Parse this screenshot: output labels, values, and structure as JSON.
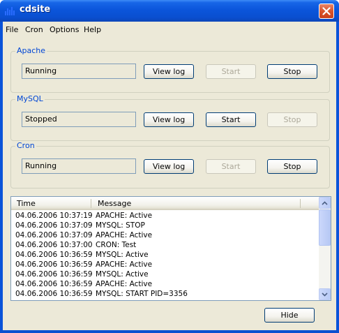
{
  "window": {
    "title": "cdsite"
  },
  "menu": {
    "items": [
      "File",
      "Cron",
      "Options",
      "Help"
    ]
  },
  "groups": [
    {
      "label": "Apache",
      "status": "Running",
      "view_log": "View log",
      "start": "Start",
      "stop": "Stop",
      "start_enabled": false,
      "stop_enabled": true
    },
    {
      "label": "MySQL",
      "status": "Stopped",
      "view_log": "View log",
      "start": "Start",
      "stop": "Stop",
      "start_enabled": true,
      "stop_enabled": false
    },
    {
      "label": "Cron",
      "status": "Running",
      "view_log": "View log",
      "start": "Start",
      "stop": "Stop",
      "start_enabled": false,
      "stop_enabled": true
    }
  ],
  "log": {
    "columns": [
      "Time",
      "Message"
    ],
    "rows": [
      [
        "04.06.2006 10:37:19",
        "APACHE: Active"
      ],
      [
        "04.06.2006 10:37:09",
        "MYSQL: STOP"
      ],
      [
        "04.06.2006 10:37:09",
        "APACHE: Active"
      ],
      [
        "04.06.2006 10:37:00",
        "CRON: Test"
      ],
      [
        "04.06.2006 10:36:59",
        "MYSQL: Active"
      ],
      [
        "04.06.2006 10:36:59",
        "APACHE: Active"
      ],
      [
        "04.06.2006 10:36:59",
        "MYSQL: Active"
      ],
      [
        "04.06.2006 10:36:59",
        "APACHE: Active"
      ],
      [
        "04.06.2006 10:36:59",
        "MYSQL: START PID=3356"
      ]
    ]
  },
  "footer": {
    "hide_label": "Hide"
  },
  "icons": {
    "app": "bar-chart-icon",
    "close": "close-icon",
    "scroll_up": "scroll-up-arrow-icon",
    "scroll_down": "scroll-down-arrow-icon"
  },
  "colors": {
    "title_bar": "#0a53d9",
    "group_label": "#0046d5",
    "close_button": "#d9542c"
  }
}
